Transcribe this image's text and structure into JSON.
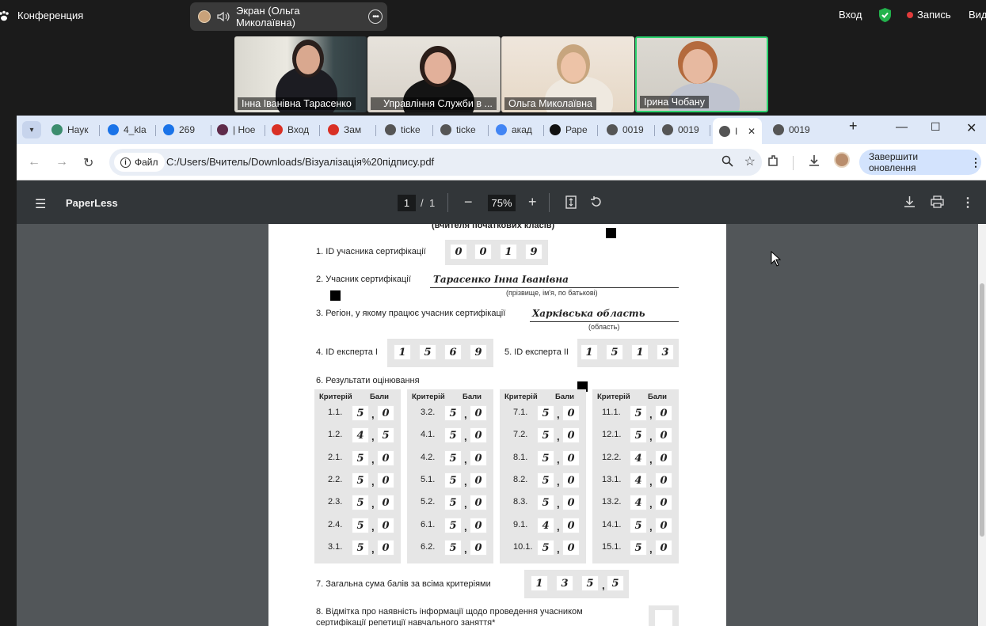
{
  "zoom": {
    "app_title": "Конференция",
    "share_label": "Экран (Ольга Миколаївна)",
    "right": {
      "login": "Вход",
      "record": "Запись",
      "view": "Вид"
    }
  },
  "participants": [
    {
      "name": "Інна Іванівна Тарасенко"
    },
    {
      "name": "Управління Служби в ..."
    },
    {
      "name": "Ольга Миколаївна"
    },
    {
      "name": "Ірина Чобану"
    }
  ],
  "browser": {
    "tabs": [
      {
        "label": "Наук",
        "color": "#3c8d6e"
      },
      {
        "label": "4_kla",
        "color": "#1a73e8"
      },
      {
        "label": "269",
        "color": "#1a73e8"
      },
      {
        "label": "| Ное",
        "color": "#5f2b4a"
      },
      {
        "label": "Вход",
        "color": "#d93025"
      },
      {
        "label": "Зам",
        "color": "#d93025"
      },
      {
        "label": "ticke",
        "color": "#555"
      },
      {
        "label": "ticke",
        "color": "#555"
      },
      {
        "label": "акад",
        "color": "#4285f4"
      },
      {
        "label": "Раре",
        "color": "#111"
      },
      {
        "label": "0019",
        "color": "#555"
      },
      {
        "label": "0019",
        "color": "#555"
      },
      {
        "label": "I",
        "color": "#555"
      },
      {
        "label": "0019",
        "color": "#555"
      }
    ],
    "file_chip": "Файл",
    "url": "C:/Users/Вчитель/Downloads/Візуалізація%20підпису.pdf",
    "update_button": "Завершити оновлення"
  },
  "pdf": {
    "title": "PaperLess",
    "page_current": "1",
    "page_sep": "/",
    "page_total": "1",
    "zoom": "75%",
    "doc": {
      "header_cut": "(вчителя початкових класів)",
      "q1": "1. ID учасника сертифікації",
      "q1_digits": [
        "0",
        "0",
        "1",
        "9"
      ],
      "q2": "2. Учасник сертифікації",
      "q2_value": "Тарасенко Інна Іванівна",
      "q2_hint": "(прізвище, ім'я, по батькові)",
      "q3": "3. Регіон, у якому працює учасник сертифікації",
      "q3_value": "Харківська область",
      "q3_hint": "(область)",
      "q4": "4. ID експерта I",
      "q4_digits": [
        "1",
        "5",
        "6",
        "9"
      ],
      "q5": "5. ID експерта II",
      "q5_digits": [
        "1",
        "5",
        "1",
        "3"
      ],
      "q6": "6. Результати оцінювання",
      "col_criterion": "Критерій",
      "col_points": "Бали",
      "results": [
        [
          [
            "1.1.",
            "5",
            "0"
          ],
          [
            "1.2.",
            "4",
            "5"
          ],
          [
            "2.1.",
            "5",
            "0"
          ],
          [
            "2.2.",
            "5",
            "0"
          ],
          [
            "2.3.",
            "5",
            "0"
          ],
          [
            "2.4.",
            "5",
            "0"
          ],
          [
            "3.1.",
            "5",
            "0"
          ]
        ],
        [
          [
            "3.2.",
            "5",
            "0"
          ],
          [
            "4.1.",
            "5",
            "0"
          ],
          [
            "4.2.",
            "5",
            "0"
          ],
          [
            "5.1.",
            "5",
            "0"
          ],
          [
            "5.2.",
            "5",
            "0"
          ],
          [
            "6.1.",
            "5",
            "0"
          ],
          [
            "6.2.",
            "5",
            "0"
          ]
        ],
        [
          [
            "7.1.",
            "5",
            "0"
          ],
          [
            "7.2.",
            "5",
            "0"
          ],
          [
            "8.1.",
            "5",
            "0"
          ],
          [
            "8.2.",
            "5",
            "0"
          ],
          [
            "8.3.",
            "5",
            "0"
          ],
          [
            "9.1.",
            "4",
            "0"
          ],
          [
            "10.1.",
            "5",
            "0"
          ]
        ],
        [
          [
            "11.1.",
            "5",
            "0"
          ],
          [
            "12.1.",
            "5",
            "0"
          ],
          [
            "12.2.",
            "4",
            "0"
          ],
          [
            "13.1.",
            "4",
            "0"
          ],
          [
            "13.2.",
            "4",
            "0"
          ],
          [
            "14.1.",
            "5",
            "0"
          ],
          [
            "15.1.",
            "5",
            "0"
          ]
        ]
      ],
      "q7": "7. Загальна сума балів за всіма критеріями",
      "q7_digits": [
        "1",
        "3",
        "5",
        "5"
      ],
      "q8_line1": "8. Відмітка про наявність інформації щодо проведення учасником",
      "q8_line2": "сертифікації репетиції навчального заняття*"
    }
  }
}
